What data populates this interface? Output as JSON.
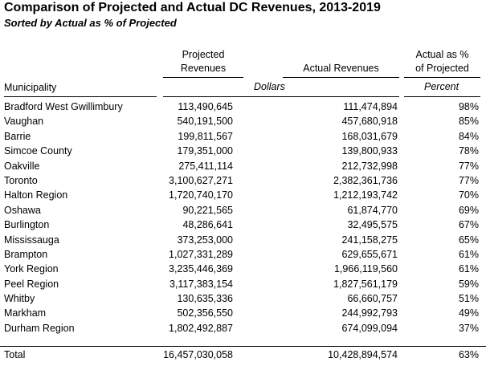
{
  "title": "Comparison of Projected and Actual DC Revenues, 2013-2019",
  "subtitle": "Sorted by Actual as % of Projected",
  "headers": {
    "projected_line1": "Projected",
    "projected_line2": "Revenues",
    "actual": "Actual Revenues",
    "pct_line1": "Actual as %",
    "pct_line2": "of Projected",
    "municipality": "Municipality",
    "unit_dollars": "Dollars",
    "unit_percent": "Percent"
  },
  "rows": [
    {
      "municipality": "Bradford West Gwillimbury",
      "projected": "113,490,645",
      "actual": "111,474,894",
      "pct": "98%"
    },
    {
      "municipality": "Vaughan",
      "projected": "540,191,500",
      "actual": "457,680,918",
      "pct": "85%"
    },
    {
      "municipality": "Barrie",
      "projected": "199,811,567",
      "actual": "168,031,679",
      "pct": "84%"
    },
    {
      "municipality": "Simcoe County",
      "projected": "179,351,000",
      "actual": "139,800,933",
      "pct": "78%"
    },
    {
      "municipality": "Oakville",
      "projected": "275,411,114",
      "actual": "212,732,998",
      "pct": "77%"
    },
    {
      "municipality": "Toronto",
      "projected": "3,100,627,271",
      "actual": "2,382,361,736",
      "pct": "77%"
    },
    {
      "municipality": "Halton Region",
      "projected": "1,720,740,170",
      "actual": "1,212,193,742",
      "pct": "70%"
    },
    {
      "municipality": "Oshawa",
      "projected": "90,221,565",
      "actual": "61,874,770",
      "pct": "69%"
    },
    {
      "municipality": "Burlington",
      "projected": "48,286,641",
      "actual": "32,495,575",
      "pct": "67%"
    },
    {
      "municipality": "Mississauga",
      "projected": "373,253,000",
      "actual": "241,158,275",
      "pct": "65%"
    },
    {
      "municipality": "Brampton",
      "projected": "1,027,331,289",
      "actual": "629,655,671",
      "pct": "61%"
    },
    {
      "municipality": "York Region",
      "projected": "3,235,446,369",
      "actual": "1,966,119,560",
      "pct": "61%"
    },
    {
      "municipality": "Peel Region",
      "projected": "3,117,383,154",
      "actual": "1,827,561,179",
      "pct": "59%"
    },
    {
      "municipality": "Whitby",
      "projected": "130,635,336",
      "actual": "66,660,757",
      "pct": "51%"
    },
    {
      "municipality": "Markham",
      "projected": "502,356,550",
      "actual": "244,992,793",
      "pct": "49%"
    },
    {
      "municipality": "Durham Region",
      "projected": "1,802,492,887",
      "actual": "674,099,094",
      "pct": "37%"
    }
  ],
  "total": {
    "municipality": "Total",
    "projected": "16,457,030,058",
    "actual": "10,428,894,574",
    "pct": "63%"
  }
}
